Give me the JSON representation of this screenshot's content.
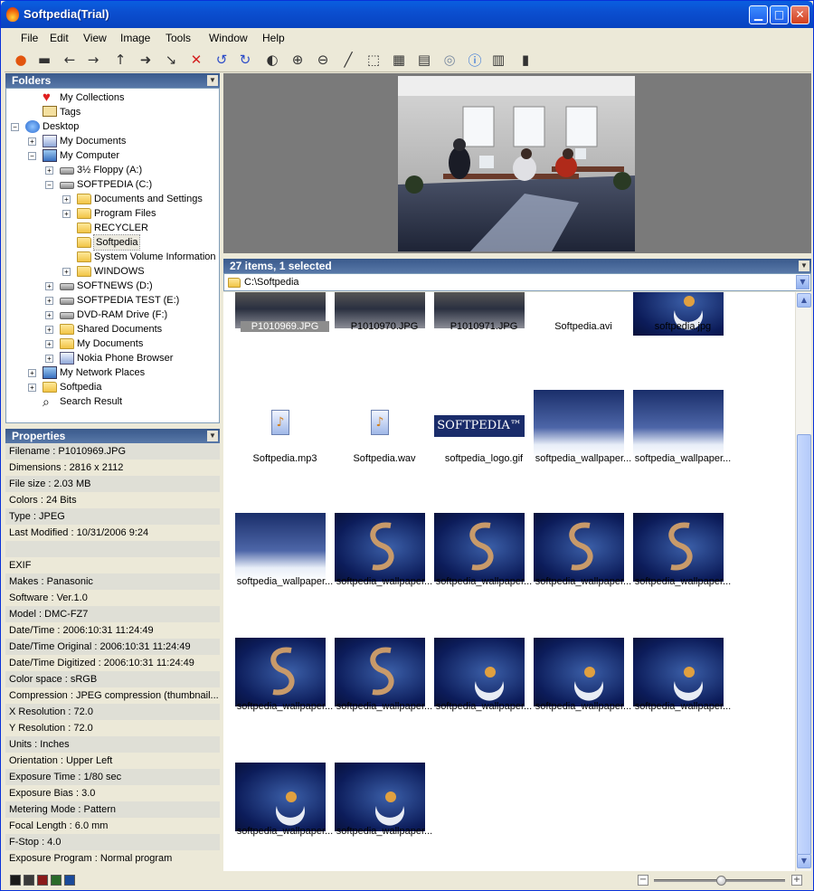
{
  "window": {
    "title": "Softpedia(Trial)"
  },
  "menu": [
    "File",
    "Edit",
    "View",
    "Image",
    "Tools",
    "Window",
    "Help"
  ],
  "toolbar_icons": [
    "open-icon",
    "print-icon",
    "back-icon",
    "forward-icon",
    "up-icon",
    "move-icon",
    "copy-icon",
    "delete-icon",
    "rotate-left-icon",
    "rotate-right-icon",
    "contrast-icon",
    "zoom-in-icon",
    "zoom-out-icon",
    "line-icon",
    "select-icon",
    "color-adjust-icon",
    "filmstrip-icon",
    "cd-icon",
    "info-icon",
    "thumbnail-view-icon",
    "color-palette-icon"
  ],
  "folders": {
    "title": "Folders",
    "items": [
      {
        "label": "My Collections",
        "icon": "heart-icon"
      },
      {
        "label": "Tags",
        "icon": "tag-icon"
      },
      {
        "label": "Desktop",
        "icon": "desktop-icon",
        "exp": "−"
      },
      {
        "label": "My Documents",
        "icon": "documents-icon",
        "exp": "+"
      },
      {
        "label": "My Computer",
        "icon": "computer-icon",
        "exp": "−"
      },
      {
        "label": "3½ Floppy (A:)",
        "icon": "floppy-icon",
        "exp": "+"
      },
      {
        "label": "SOFTPEDIA (C:)",
        "icon": "drive-icon",
        "exp": "−"
      },
      {
        "label": "Documents and Settings",
        "icon": "folder-icon",
        "exp": "+"
      },
      {
        "label": "Program Files",
        "icon": "folder-icon",
        "exp": "+"
      },
      {
        "label": "RECYCLER",
        "icon": "folder-icon"
      },
      {
        "label": "Softpedia",
        "icon": "folder-open-icon"
      },
      {
        "label": "System Volume Information",
        "icon": "folder-icon"
      },
      {
        "label": "WINDOWS",
        "icon": "folder-icon",
        "exp": "+"
      },
      {
        "label": "SOFTNEWS (D:)",
        "icon": "drive-icon",
        "exp": "+"
      },
      {
        "label": "SOFTPEDIA TEST (E:)",
        "icon": "drive-icon",
        "exp": "+"
      },
      {
        "label": "DVD-RAM Drive (F:)",
        "icon": "dvd-icon",
        "exp": "+"
      },
      {
        "label": "Shared Documents",
        "icon": "folder-icon",
        "exp": "+"
      },
      {
        "label": "My Documents",
        "icon": "folder-icon",
        "exp": "+"
      },
      {
        "label": "Nokia Phone Browser",
        "icon": "phone-icon",
        "exp": "+"
      },
      {
        "label": "My Network Places",
        "icon": "network-icon",
        "exp": "+"
      },
      {
        "label": "Softpedia",
        "icon": "folder-icon",
        "exp": "+"
      },
      {
        "label": "Search Result",
        "icon": "search-icon"
      }
    ]
  },
  "properties": {
    "title": "Properties",
    "rows": [
      "Filename : P1010969.JPG",
      "Dimensions : 2816 x 2112",
      "File size : 2.03 MB",
      "Colors : 24 Bits",
      "Type : JPEG",
      "Last Modified : 10/31/2006 9:24",
      "",
      "EXIF",
      "Makes : Panasonic",
      "Software : Ver.1.0",
      "Model : DMC-FZ7",
      "Date/Time : 2006:10:31 11:24:49",
      "Date/Time Original : 2006:10:31 11:24:49",
      "Date/Time Digitized : 2006:10:31 11:24:49",
      "Color space : sRGB",
      "Compression : JPEG compression (thumbnail...",
      "X Resolution : 72.0",
      "Y Resolution : 72.0",
      "Units : Inches",
      "Orientation : Upper Left",
      "Exposure Time : 1/80 sec",
      "Exposure Bias : 3.0",
      "Metering Mode : Pattern",
      "Focal Length : 6.0 mm",
      "F-Stop : 4.0",
      "Exposure Program : Normal program"
    ]
  },
  "browser": {
    "status": "27 items, 1 selected",
    "path": "C:\\Softpedia",
    "files": [
      {
        "name": "P1010969.JPG",
        "kind": "photo",
        "selected": true
      },
      {
        "name": "P1010970.JPG",
        "kind": "photo"
      },
      {
        "name": "P1010971.JPG",
        "kind": "photo"
      },
      {
        "name": "Softpedia.avi",
        "kind": "media"
      },
      {
        "name": "softpedia.jpg",
        "kind": "wp-moon"
      },
      {
        "name": "Softpedia.mp3",
        "kind": "audio"
      },
      {
        "name": "Softpedia.wav",
        "kind": "audio"
      },
      {
        "name": "softpedia_logo.gif",
        "kind": "logo",
        "logo_text": "SOFTPEDIA™"
      },
      {
        "name": "softpedia_wallpaper...",
        "kind": "wp-girl"
      },
      {
        "name": "softpedia_wallpaper...",
        "kind": "wp-girl"
      },
      {
        "name": "softpedia_wallpaper...",
        "kind": "wp-girl"
      },
      {
        "name": "softpedia_wallpaper...",
        "kind": "wp-s"
      },
      {
        "name": "softpedia_wallpaper...",
        "kind": "wp-s"
      },
      {
        "name": "softpedia_wallpaper...",
        "kind": "wp-s"
      },
      {
        "name": "softpedia_wallpaper...",
        "kind": "wp-s"
      },
      {
        "name": "softpedia_wallpaper...",
        "kind": "wp-s"
      },
      {
        "name": "softpedia_wallpaper...",
        "kind": "wp-s"
      },
      {
        "name": "softpedia_wallpaper...",
        "kind": "wp-moon"
      },
      {
        "name": "softpedia_wallpaper...",
        "kind": "wp-moon"
      },
      {
        "name": "softpedia_wallpaper...",
        "kind": "wp-moon"
      },
      {
        "name": "softpedia_wallpaper...",
        "kind": "wp-moon"
      },
      {
        "name": "softpedia_wallpaper...",
        "kind": "wp-moon"
      }
    ]
  },
  "zoom": {
    "level": 0.51
  },
  "swatches": [
    "#1a1a1a",
    "#3a3a3a",
    "#8a1a1a",
    "#2a6a2a",
    "#1a4a9a"
  ]
}
